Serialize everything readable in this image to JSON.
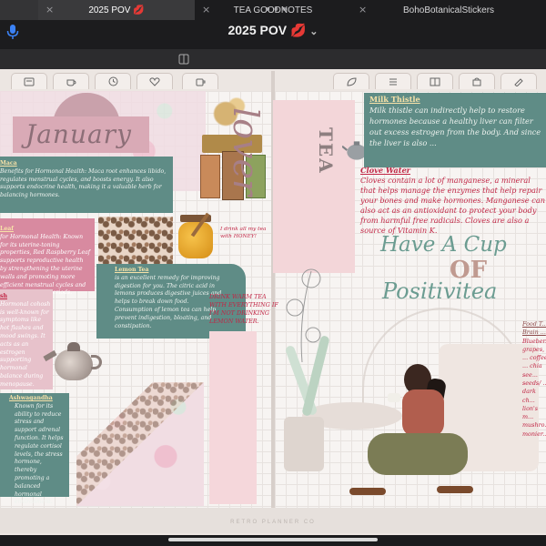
{
  "app": {
    "more_dots": "•••",
    "title": "2025 POV",
    "title_emoji": "💋",
    "title_chevron": "⌄"
  },
  "tabs": [
    {
      "label": "2025 POV 💋",
      "active": true
    },
    {
      "label": "TEA GOODNOTES",
      "active": false
    },
    {
      "label": "BohoBotanicalStickers",
      "active": false
    }
  ],
  "tab_close": "×",
  "planner": {
    "month": "January",
    "tea_lover_script": "lover",
    "tea_lover_word": "TEA",
    "have_a_cup": "Have A Cup",
    "of": "OF",
    "positivitea": "Positivitea",
    "footer_brand": "RETRO PLANNER CO"
  },
  "notes": {
    "maca": {
      "heading": "Maca",
      "body": "Benefits for Hormonal Health: Maca root enhances libido, regulates menstrual cycles, and boosts energy. It also supports endocrine health, making it a valuable herb for balancing hormones."
    },
    "leaf": {
      "heading": "Leaf",
      "body": "for Hormonal Health: Known for its uterine-toning properties, Red Raspberry Leaf supports reproductive health by strengthening the uterine walls and promoting more efficient menstrual cycles and reducing painful periods."
    },
    "ash": {
      "heading": "sh",
      "body": "Hormonal cohosh is well-known for symptoms like hot flashes and mood swings. It acts as an estrogen supporting hormonal balance during menopause."
    },
    "lemon": {
      "heading": "Lemon Tea",
      "body": "is an excellent remedy for improving digestion for you. The citric acid in lemons produces digestive juices and helps to break down food. Consumption of lemon tea can help prevent indigestion, bloating, and constipation."
    },
    "ashwagandha": {
      "heading": "Ashwagandha",
      "body": "Known for its ability to reduce stress and support adrenal function. It helps regulate cortisol levels, the stress hormone, thereby promoting a balanced hormonal environment."
    },
    "milk_thistle": {
      "heading": "Milk Thistle",
      "body": "Milk thistle can indirectly help to restore hormones because a healthy liver can filter out excess estrogen from the body. And since the liver is also ..."
    },
    "clove": {
      "heading": "Clove Water",
      "body": "Cloves contain a lot of manganese, a mineral that helps manage the enzymes that help repair your bones and make hormones. Manganese can also act as an antioxidant to protect your body from harmful free radicals. Cloves are also a source of Vitamin K."
    },
    "honey": "I drink all my tea with HONEY!",
    "drink_warm": "DRINK WARM TEA WITH EVERYTHING IF I'M NOT DRINKING LEMON WATER.",
    "food": {
      "heading": "Food T... Brain ...",
      "body": "Blueber... grapes, ... coffee, ... chia see... seeds/ ... dark ch... lion's m... mushro... monier..."
    }
  },
  "icons": [
    "notebook-icon",
    "tea-icon",
    "clock-icon",
    "heart-icon",
    "cup-icon",
    "leaf-icon",
    "list-icon",
    "book-icon",
    "bag-icon",
    "checklist-icon",
    "pencil-icon"
  ]
}
